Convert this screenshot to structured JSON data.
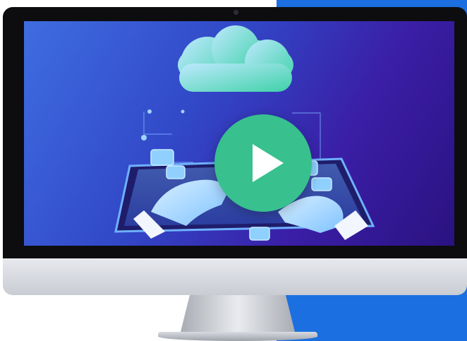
{
  "screen": {
    "illustration": "cloud-computing-illustration",
    "play_button_icon": "play-icon"
  },
  "colors": {
    "panel_blue": "#1b6fe0",
    "play_green": "#38c08f",
    "screen_gradient_start": "#3f6de0",
    "screen_gradient_end": "#2a1280"
  }
}
